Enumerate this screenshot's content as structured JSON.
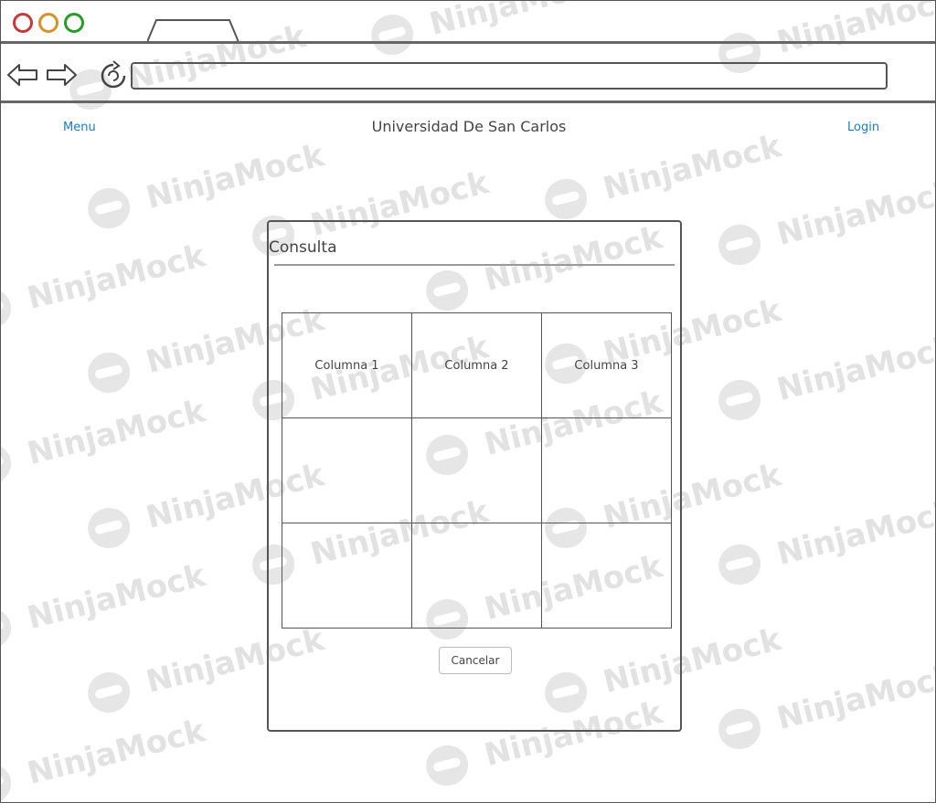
{
  "browser": {
    "address": ""
  },
  "header": {
    "menu_label": "Menu",
    "title": "Universidad De San Carlos",
    "login_label": "Login"
  },
  "panel": {
    "title": "Consulta",
    "table": {
      "columns": [
        "Columna 1",
        "Columna 2",
        "Columna 3"
      ],
      "rows": [
        [
          "",
          "",
          ""
        ],
        [
          "",
          "",
          ""
        ]
      ]
    },
    "cancel_label": "Cancelar"
  },
  "watermark": {
    "text": "NinjaMock"
  },
  "colors": {
    "link": "#1e7bbf",
    "close_dot": "#c43b3b",
    "minimize_dot": "#d8912a",
    "maximize_dot": "#2a9a2a"
  }
}
